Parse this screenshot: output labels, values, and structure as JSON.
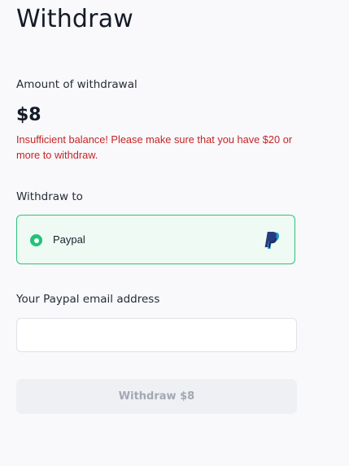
{
  "page": {
    "title": "Withdraw"
  },
  "amount_section": {
    "label": "Amount of withdrawal",
    "amount": "$8",
    "error": "Insufficient balance! Please make sure that you have $20 or more to withdraw."
  },
  "withdraw_to": {
    "label": "Withdraw to",
    "options": [
      {
        "label": "Paypal",
        "selected": true,
        "icon": "paypal-logo"
      }
    ]
  },
  "email": {
    "label": "Your Paypal email address",
    "value": "",
    "placeholder": ""
  },
  "submit": {
    "label": "Withdraw $8",
    "disabled": true
  },
  "colors": {
    "accent": "#22c27a",
    "error": "#c52424",
    "paypal_dark": "#253b80",
    "paypal_light": "#179bd7"
  }
}
